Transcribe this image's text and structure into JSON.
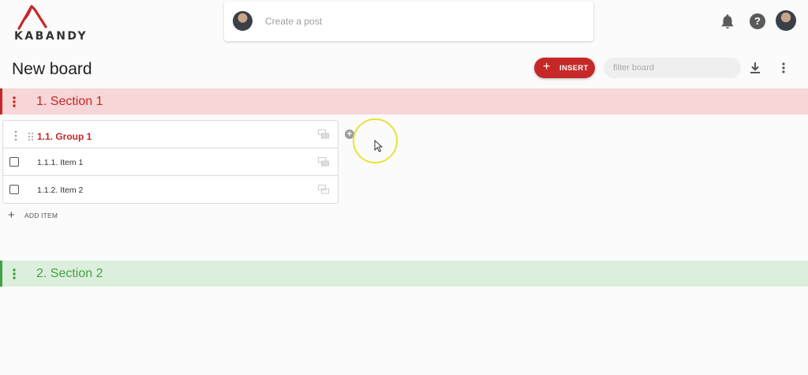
{
  "header": {
    "logo_text": "KABANDY",
    "post_placeholder": "Create a post",
    "help_glyph": "?",
    "icons": [
      "notifications-bell-icon",
      "help-icon",
      "user-avatar"
    ]
  },
  "board": {
    "title": "New board",
    "insert_label": "INSERT",
    "filter_placeholder": "filter board",
    "accent_color": "#c62828"
  },
  "sections": [
    {
      "title": "1. Section 1",
      "color": "#c62828",
      "groups": [
        {
          "title": "1.1. Group 1",
          "items": [
            {
              "label": "1.1.1. Item 1"
            },
            {
              "label": "1.1.2. Item 2"
            }
          ]
        }
      ],
      "add_item_label": "ADD ITEM"
    },
    {
      "title": "2. Section 2",
      "color": "#43a047"
    }
  ]
}
